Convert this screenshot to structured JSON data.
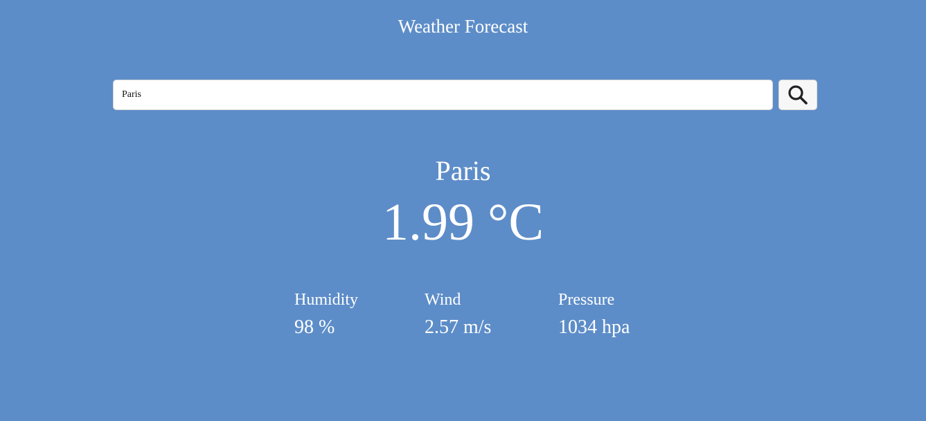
{
  "header": {
    "title": "Weather Forecast"
  },
  "search": {
    "value": "Paris",
    "icon": "search-icon"
  },
  "current": {
    "city": "Paris",
    "temperature": "1.99 °C"
  },
  "stats": {
    "humidity": {
      "label": "Humidity",
      "value": "98 %"
    },
    "wind": {
      "label": "Wind",
      "value": "2.57 m/s"
    },
    "pressure": {
      "label": "Pressure",
      "value": "1034 hpa"
    }
  },
  "colors": {
    "background": "#5d8dc8",
    "text": "#ffffff",
    "input_background": "#ffffff",
    "button_background": "#f7f7f7",
    "icon": "#222222"
  }
}
